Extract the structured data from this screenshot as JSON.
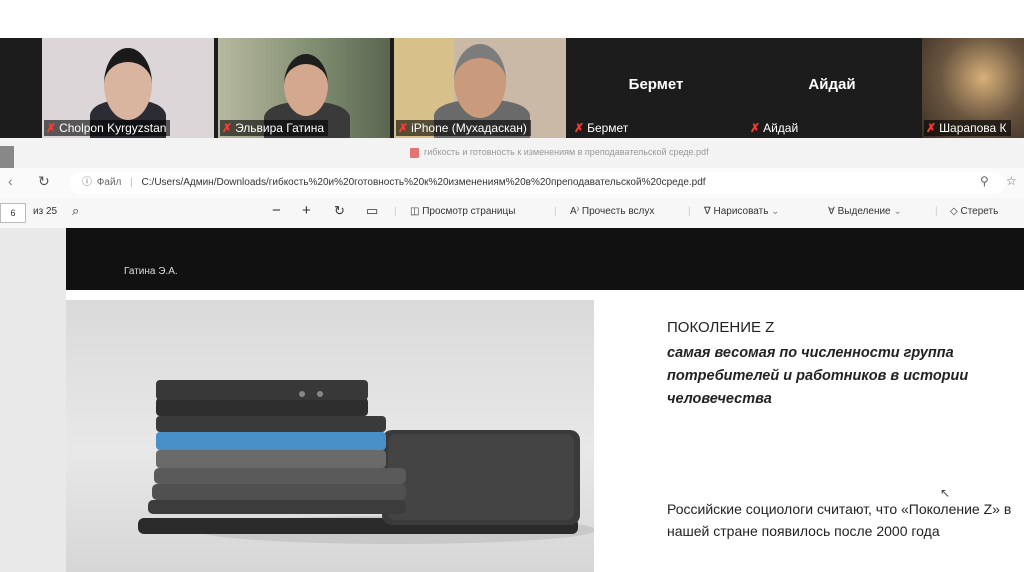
{
  "participants": [
    {
      "name": "Cholpon Kyrgyzstan",
      "type": "video"
    },
    {
      "name": "Эльвира Гатина",
      "type": "video",
      "active": true
    },
    {
      "name": "iPhone (Мухадаскан)",
      "type": "video"
    },
    {
      "name": "Бермет",
      "type": "avatar",
      "big_label": "Бермет"
    },
    {
      "name": "Айдай",
      "type": "avatar",
      "big_label": "Айдай"
    },
    {
      "name": "Шарапова К",
      "type": "video"
    }
  ],
  "browser": {
    "tab_title": "гибкость и готовность к изменениям в преподавательской среде.pdf",
    "file_label": "Файл",
    "address": "C:/Users/Админ/Downloads/гибкость%20и%20готовность%20к%20изменениям%20в%20преподавательской%20среде.pdf"
  },
  "pdf_toolbar": {
    "page_number": "6",
    "page_total": "из 25",
    "page_view": "Просмотр страницы",
    "read_aloud": "Прочесть вслух",
    "draw": "Нарисовать",
    "highlight": "Выделение",
    "erase": "Стереть"
  },
  "slide": {
    "author": "Гатина Э.А.",
    "title": "ПОКОЛЕНИЕ Z",
    "subtitle": "самая весомая по численности группа потребителей и работников в истории человечества",
    "paragraph": "Российские социологи считают, что «Поколение Z» в нашей стране появилось после 2000 года"
  },
  "colors": {
    "zoom_bg": "#1c1c1c",
    "muted_mic": "#ff3b30",
    "active_speaker": "#c8e04a",
    "slide_header": "#111111"
  }
}
